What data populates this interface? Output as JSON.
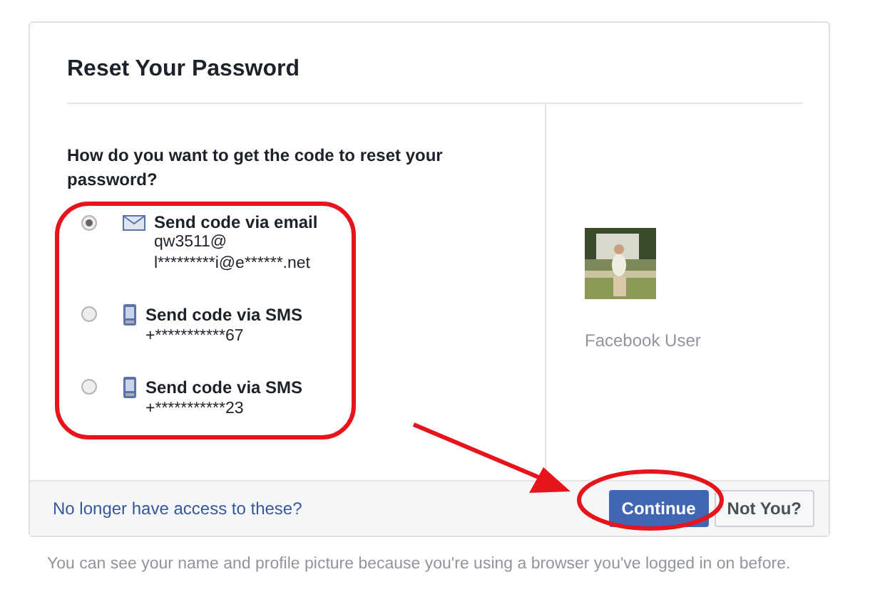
{
  "dialog": {
    "title": "Reset Your Password",
    "question": "How do you want to get the code to reset your password?",
    "options": [
      {
        "kind": "email",
        "label": "Send code via email",
        "details": [
          "qw3511@",
          "l*********i@e******.net"
        ],
        "selected": true
      },
      {
        "kind": "sms",
        "label": "Send code via SMS",
        "details": [
          "+***********67"
        ],
        "selected": false
      },
      {
        "kind": "sms",
        "label": "Send code via SMS",
        "details": [
          "+***********23"
        ],
        "selected": false
      }
    ],
    "profile": {
      "name": "Facebook User"
    },
    "footer": {
      "link": "No longer have access to these?",
      "buttons": [
        {
          "label": "Continue",
          "kind": "primary"
        },
        {
          "label": "Not You?",
          "kind": "secondary"
        }
      ]
    }
  },
  "note": "You can see your name and profile picture because you're using a browser you've logged in on before."
}
